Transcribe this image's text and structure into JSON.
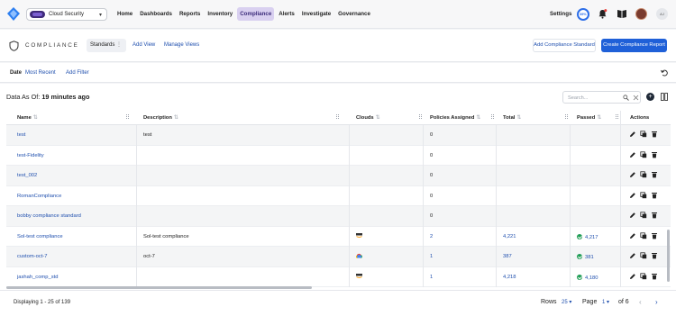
{
  "nav": {
    "tenant": "Cloud Security",
    "links": [
      {
        "label": "Home"
      },
      {
        "label": "Dashboards"
      },
      {
        "label": "Reports"
      },
      {
        "label": "Inventory"
      },
      {
        "label": "Compliance",
        "active": true
      },
      {
        "label": "Alerts"
      },
      {
        "label": "Investigate"
      },
      {
        "label": "Governance"
      }
    ],
    "settings": "Settings",
    "ring_value": "89%",
    "user_initials": "AJ"
  },
  "subheader": {
    "title": "COMPLIANCE",
    "tab": "Standards",
    "add_view": "Add View",
    "manage_views": "Manage Views",
    "add_standard_btn": "Add Compliance Standard",
    "create_report_btn": "Create Compliance Report"
  },
  "filters": {
    "date_label": "Date",
    "date_value": "Most Recent",
    "add_filter": "Add Filter"
  },
  "table": {
    "as_of_prefix": "Data As Of:",
    "as_of_value": "19 minutes ago",
    "search_placeholder": "Search...",
    "columns": [
      "Name",
      "Description",
      "Clouds",
      "Policies Assigned",
      "Total",
      "Passed",
      "Actions"
    ],
    "rows": [
      {
        "name": "test",
        "description": "test",
        "cloud": "",
        "policies": "0",
        "total": "",
        "passed": ""
      },
      {
        "name": "test-Fidelity",
        "description": "",
        "cloud": "",
        "policies": "0",
        "total": "",
        "passed": ""
      },
      {
        "name": "test_002",
        "description": "",
        "cloud": "",
        "policies": "0",
        "total": "",
        "passed": ""
      },
      {
        "name": "RomanCompliance",
        "description": "",
        "cloud": "",
        "policies": "0",
        "total": "",
        "passed": ""
      },
      {
        "name": "bobby compliance standard",
        "description": "",
        "cloud": "",
        "policies": "0",
        "total": "",
        "passed": ""
      },
      {
        "name": "Sol-test compliance",
        "description": "Sol-test compliance",
        "cloud": "aws",
        "policies": "2",
        "total": "4,221",
        "passed": "4,217"
      },
      {
        "name": "custom-oct-7",
        "description": "oct-7",
        "cloud": "gcp",
        "policies": "1",
        "total": "387",
        "passed": "381"
      },
      {
        "name": "jashah_comp_std",
        "description": "",
        "cloud": "aws",
        "policies": "1",
        "total": "4,218",
        "passed": "4,180"
      }
    ]
  },
  "footer": {
    "displaying": "Displaying 1 - 25 of 139",
    "rows_label": "Rows",
    "rows_value": "25",
    "page_label": "Page",
    "page_value": "1",
    "of_pages": "of 6"
  },
  "colors": {
    "accent": "#1f60d8",
    "link": "#1f4fae",
    "passed": "#1f9d55",
    "active_nav": "#d9d0f0"
  }
}
